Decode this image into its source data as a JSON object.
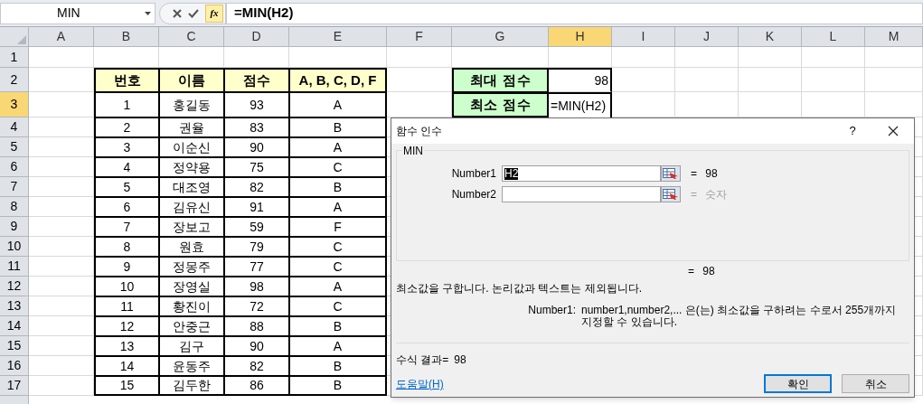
{
  "formula_bar": {
    "name_box": "MIN",
    "fx_label": "fx",
    "formula": "=MIN(H2)"
  },
  "columns": [
    {
      "label": "A",
      "selected": false
    },
    {
      "label": "B",
      "selected": false
    },
    {
      "label": "C",
      "selected": false
    },
    {
      "label": "D",
      "selected": false
    },
    {
      "label": "E",
      "selected": false
    },
    {
      "label": "F",
      "selected": false
    },
    {
      "label": "G",
      "selected": false
    },
    {
      "label": "H",
      "selected": true
    },
    {
      "label": "I",
      "selected": false
    },
    {
      "label": "J",
      "selected": false
    },
    {
      "label": "K",
      "selected": false
    },
    {
      "label": "L",
      "selected": false
    },
    {
      "label": "M",
      "selected": false
    }
  ],
  "rows": [
    {
      "label": "1",
      "selected": false
    },
    {
      "label": "2",
      "selected": false
    },
    {
      "label": "3",
      "selected": true
    },
    {
      "label": "4",
      "selected": false
    },
    {
      "label": "5",
      "selected": false
    },
    {
      "label": "6",
      "selected": false
    },
    {
      "label": "7",
      "selected": false
    },
    {
      "label": "8",
      "selected": false
    },
    {
      "label": "9",
      "selected": false
    },
    {
      "label": "10",
      "selected": false
    },
    {
      "label": "11",
      "selected": false
    },
    {
      "label": "12",
      "selected": false
    },
    {
      "label": "13",
      "selected": false
    },
    {
      "label": "14",
      "selected": false
    },
    {
      "label": "15",
      "selected": false
    },
    {
      "label": "16",
      "selected": false
    },
    {
      "label": "17",
      "selected": false
    }
  ],
  "table": {
    "columns": [
      "번호",
      "이름",
      "점수",
      "A, B, C, D, F"
    ],
    "rows": [
      [
        "1",
        "홍길동",
        "93",
        "A"
      ],
      [
        "2",
        "권율",
        "83",
        "B"
      ],
      [
        "3",
        "이순신",
        "90",
        "A"
      ],
      [
        "4",
        "정약용",
        "75",
        "C"
      ],
      [
        "5",
        "대조영",
        "82",
        "B"
      ],
      [
        "6",
        "김유신",
        "91",
        "A"
      ],
      [
        "7",
        "장보고",
        "59",
        "F"
      ],
      [
        "8",
        "원효",
        "79",
        "C"
      ],
      [
        "9",
        "정몽주",
        "77",
        "C"
      ],
      [
        "10",
        "장영실",
        "98",
        "A"
      ],
      [
        "11",
        "황진이",
        "72",
        "C"
      ],
      [
        "12",
        "안중근",
        "88",
        "B"
      ],
      [
        "13",
        "김구",
        "90",
        "A"
      ],
      [
        "14",
        "윤동주",
        "82",
        "B"
      ],
      [
        "15",
        "김두한",
        "86",
        "B"
      ]
    ]
  },
  "summary": [
    {
      "label": "최대 점수",
      "value": "98",
      "editing": false
    },
    {
      "label": "최소 점수",
      "value": "=MIN(H2)",
      "editing": true
    }
  ],
  "dialog": {
    "title": "함수 인수",
    "help_glyph": "?",
    "function_name": "MIN",
    "arguments": [
      {
        "label": "Number1",
        "value": "H2",
        "value_selected": true,
        "result": "= 98"
      },
      {
        "label": "Number2",
        "result": "= 숫자"
      }
    ],
    "formula_value": "= 98",
    "description": "최소값을 구합니다. 논리값과 텍스트는 제외됩니다.",
    "argument_help_label": "Number1:",
    "argument_help": "number1,number2,... 은(는) 최소값을 구하려는 수로서 255개까지 지정할 수 있습니다.",
    "result_label": "수식 결과=",
    "result": "98",
    "help_link": "도움말(H)",
    "buttons": [
      {
        "label": "확인",
        "default": true
      },
      {
        "label": "취소",
        "default": false
      }
    ]
  }
}
